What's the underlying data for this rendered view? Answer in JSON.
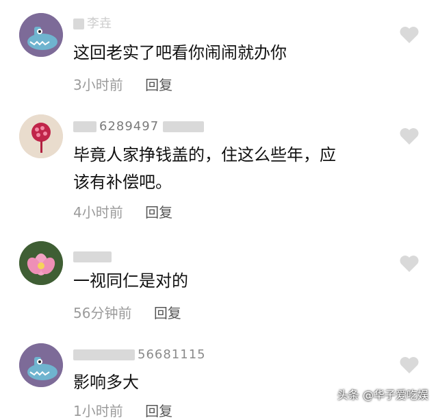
{
  "comments": [
    {
      "username": "李垚",
      "text": "这回老实了吧看你闹闹就办你",
      "time": "3小时前",
      "reply": "回复",
      "avatar": "blue-monster-avatar"
    },
    {
      "username": "6289497",
      "text_line1": "毕竟人家挣钱盖的，住这么些年，应",
      "text_line2": "该有补偿吧。",
      "time": "4小时前",
      "reply": "回复",
      "avatar": "pink-flower-avatar"
    },
    {
      "username": "",
      "text": "一视同仁是对的",
      "time": "56分钟前",
      "reply": "回复",
      "avatar": "lotus-avatar"
    },
    {
      "username": "56681115",
      "text": "影响多大",
      "time": "1小时前",
      "reply": "回复",
      "avatar": "blue-monster-avatar"
    }
  ],
  "watermark": "头条 @华子爱吃娱",
  "icons": {
    "like": "heart-icon"
  },
  "colors": {
    "meta": "#9b9b9b",
    "heart": "#d9d9d9"
  }
}
